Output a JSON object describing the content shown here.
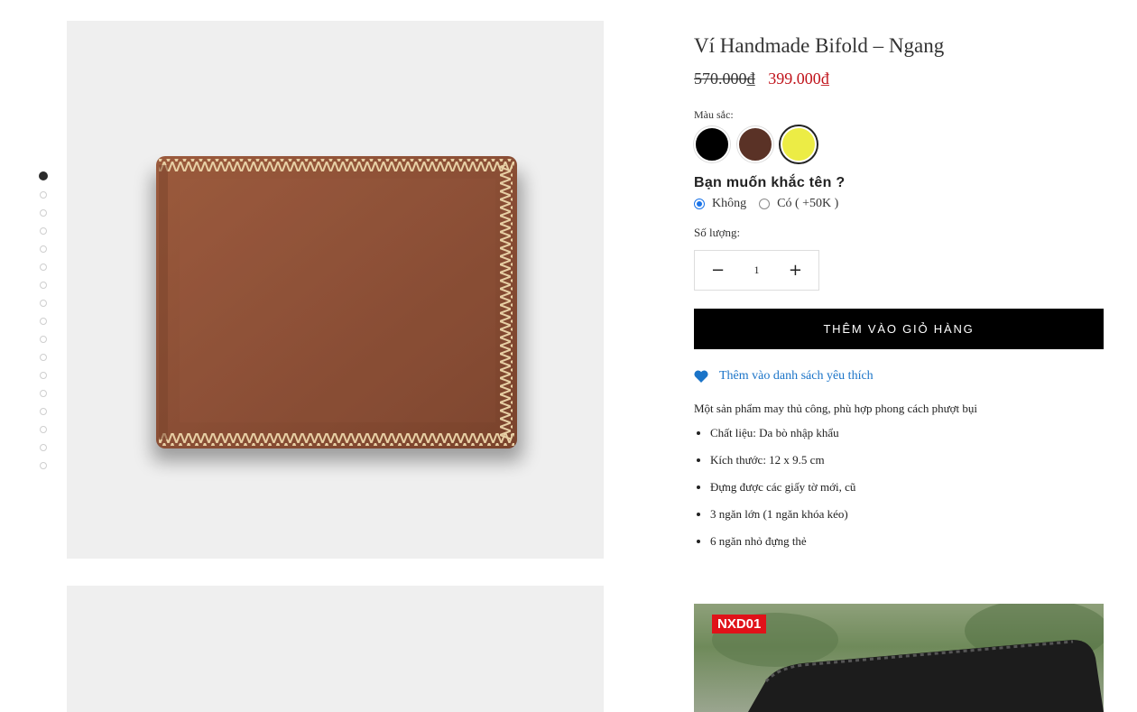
{
  "product": {
    "title": "Ví Handmade Bifold – Ngang",
    "old_price": "570.000₫",
    "new_price": "399.000₫"
  },
  "gallery": {
    "dot_count": 17,
    "active_index": 0,
    "main_image_icon": "brown-leather-bifold-wallet",
    "second_image_icon": "wallet-photo-placeholder"
  },
  "color": {
    "label": "Màu sắc:",
    "options": [
      {
        "name": "black",
        "hex": "#000000",
        "selected": false
      },
      {
        "name": "brown",
        "hex": "#5a3226",
        "selected": false
      },
      {
        "name": "yellow",
        "hex": "#ecec45",
        "selected": true
      }
    ]
  },
  "engrave": {
    "question": "Bạn muốn khắc tên ?",
    "option_no": "Không",
    "option_yes": "Có ( +50K )",
    "selected": "no"
  },
  "quantity": {
    "label": "Số lượng:",
    "value": "1"
  },
  "buttons": {
    "add_to_cart": "THÊM VÀO GIỎ HÀNG",
    "wishlist": "Thêm vào danh sách yêu thích"
  },
  "description": {
    "intro": "Một sản phẩm may thủ công, phù hợp phong cách phượt bụi",
    "bullets": [
      "Chất liệu: Da bò nhập khẩu",
      "Kích thước: 12 x 9.5 cm",
      "Đựng được các giấy tờ mới, cũ",
      "3 ngăn lớn (1 ngăn khóa kéo)",
      "6 ngăn nhỏ đựng thẻ"
    ]
  },
  "photo": {
    "badge": "NXD01"
  },
  "colors": {
    "accent_blue": "#1b74c8",
    "sale_red": "#c0121a",
    "button_black": "#000000",
    "image_bg": "#efefef"
  }
}
